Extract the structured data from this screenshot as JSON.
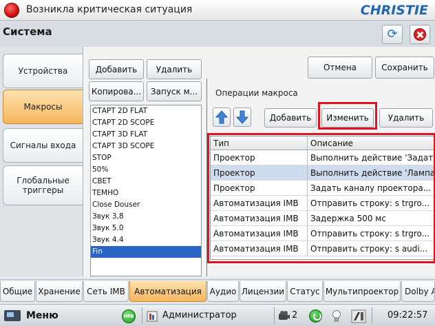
{
  "alert": {
    "text": "Возникла критическая ситуация",
    "logo": "CHRISTIE"
  },
  "header": {
    "title": "Система"
  },
  "vtabs": [
    {
      "label": "Устройства",
      "active": false
    },
    {
      "label": "Макросы",
      "active": true
    },
    {
      "label": "Сигналы входа",
      "active": false
    },
    {
      "label": "Глобальные\nтриггеры",
      "active": false
    }
  ],
  "macros_panel": {
    "add_label": "Добавить",
    "delete_label": "Удалить",
    "copy_label": "Копирова...",
    "run_label": "Запуск м...",
    "items": [
      "СТАРТ 2D FLAT",
      "СТАРТ 2D SCOPE",
      "СТАРТ 3D FLAT",
      "СТАРТ 3D SCOPE",
      "STOP",
      "50%",
      "СВЕТ",
      "ТЕМНО",
      "Close Douser",
      "Звук 3,8",
      "Звук 5.0",
      "Звук 4.4",
      "Fin"
    ],
    "selected_index": 12
  },
  "actions": {
    "cancel_label": "Отмена",
    "save_label": "Сохранить"
  },
  "operations": {
    "section_label": "Операции макроса",
    "add_label": "Добавить",
    "edit_label": "Изменить",
    "delete_label": "Удалить",
    "columns": {
      "type": "Тип",
      "description": "Описание"
    },
    "rows": [
      {
        "type": "Проектор",
        "description": "Выполнить действие 'Задать...",
        "selected": false
      },
      {
        "type": "Проектор",
        "description": "Выполнить действие 'Лампа...",
        "selected": true
      },
      {
        "type": "Проектор",
        "description": "Задать каналу проектора...",
        "selected": false
      },
      {
        "type": "Автоматизация IMB",
        "description": "Отправить строку: s trgro...",
        "selected": false
      },
      {
        "type": "Автоматизация IMB",
        "description": "Задержка 500 мс",
        "selected": false
      },
      {
        "type": "Автоматизация IMB",
        "description": "Отправить строку: s trgro...",
        "selected": false
      },
      {
        "type": "Автоматизация IMB",
        "description": "Отправить строку: s audi...",
        "selected": false
      }
    ]
  },
  "bottom_tabs": [
    {
      "label": "Общие",
      "active": false
    },
    {
      "label": "Хранение",
      "active": false
    },
    {
      "label": "Сеть IMB",
      "active": false
    },
    {
      "label": "Автоматизация",
      "active": true
    },
    {
      "label": "Аудио",
      "active": false
    },
    {
      "label": "Лицензии",
      "active": false
    },
    {
      "label": "Статус",
      "active": false
    },
    {
      "label": "Мультипроектор",
      "active": false
    },
    {
      "label": "Dolby A...",
      "active": false
    }
  ],
  "statusbar": {
    "menu_label": "Меню",
    "imb_label": "IMB",
    "user_label": "Администратор",
    "count": "2",
    "time": "09:22:57"
  }
}
